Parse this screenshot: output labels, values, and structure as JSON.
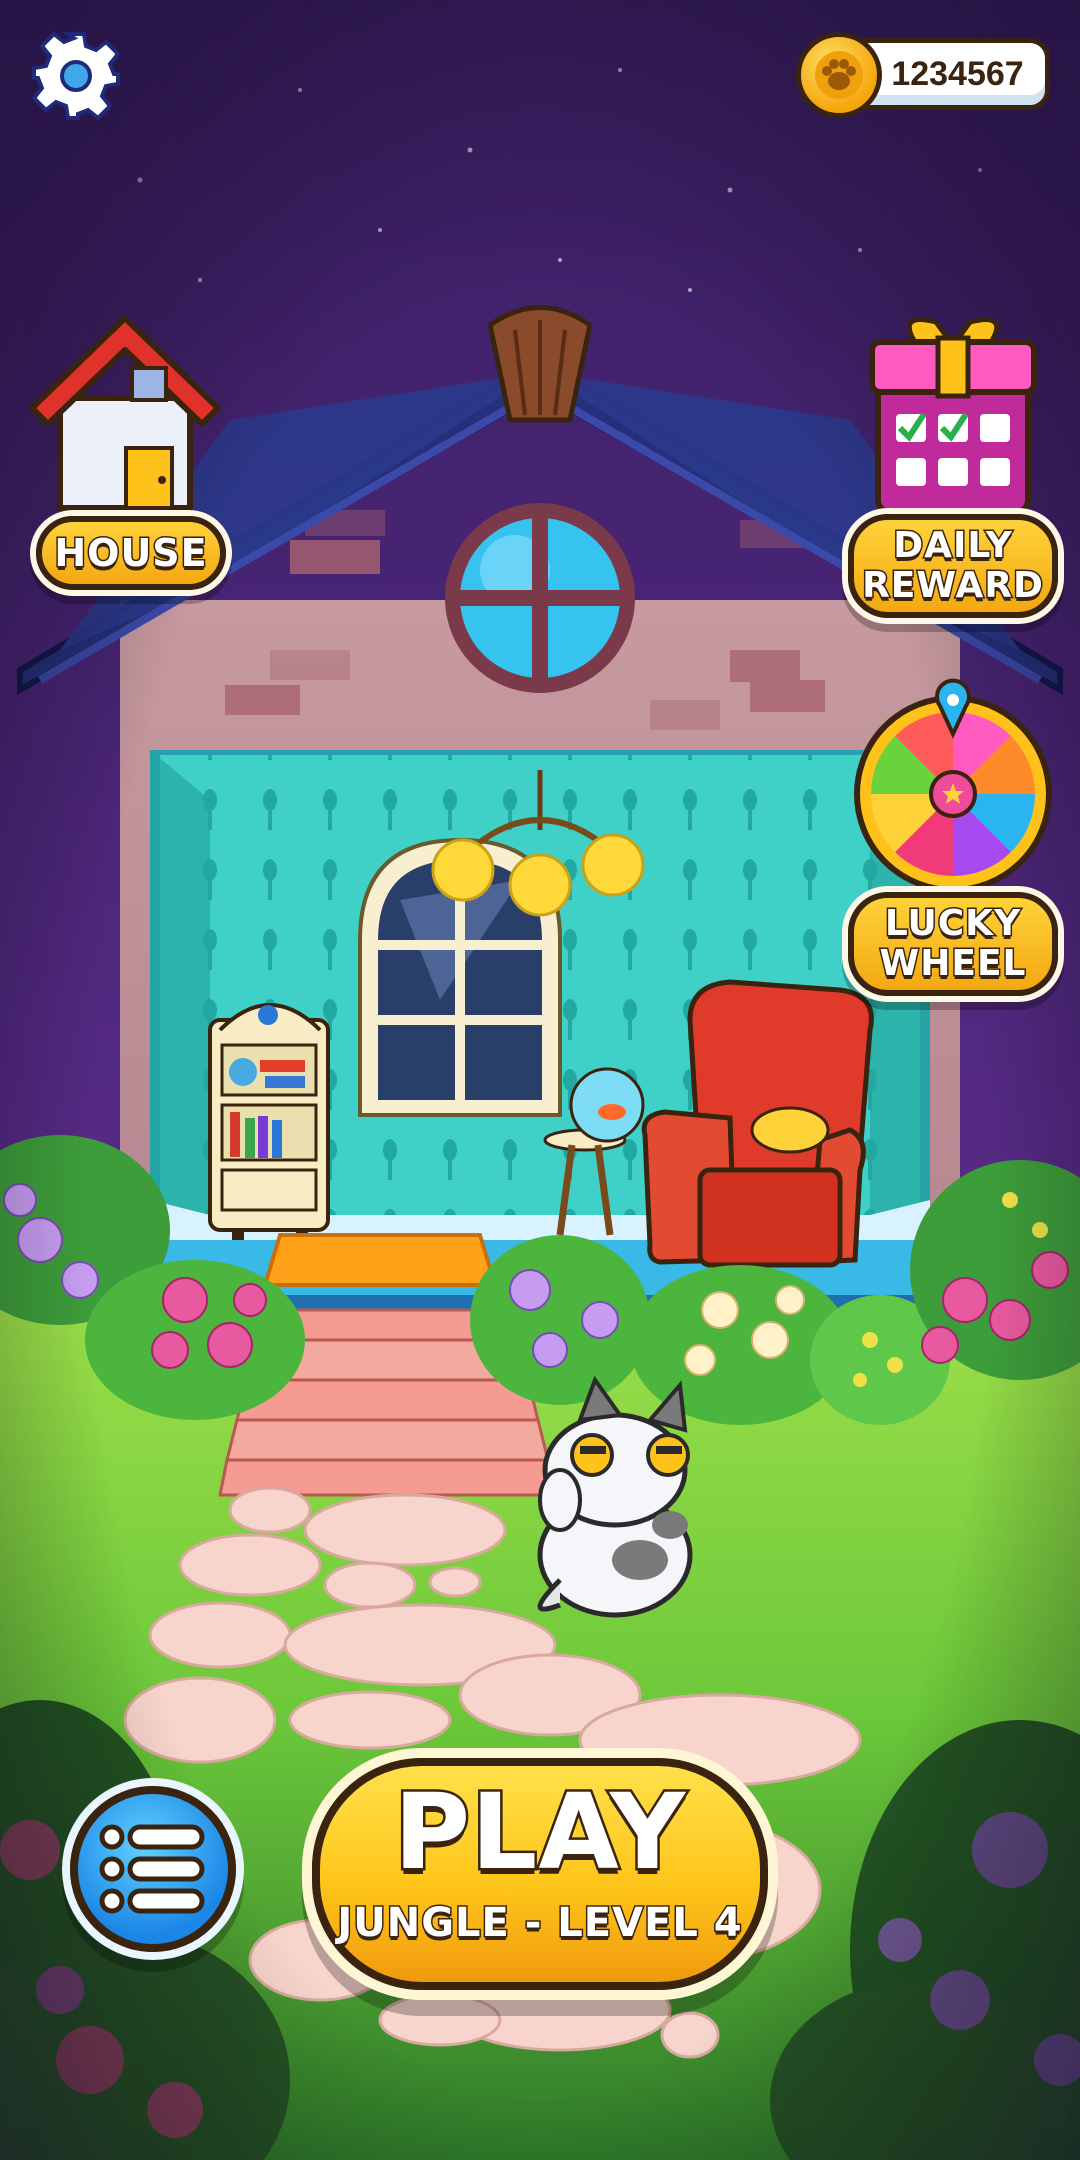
{
  "hud": {
    "settings_icon": "gear-icon",
    "coins": "1234567",
    "coin_icon": "paw-coin-icon"
  },
  "side_menu": {
    "house_label": "HOUSE",
    "daily_reward_line1": "DAILY",
    "daily_reward_line2": "REWARD",
    "lucky_wheel_line1": "LUCKY",
    "lucky_wheel_line2": "WHEEL"
  },
  "play": {
    "label": "PLAY",
    "subtitle": "JUNGLE - LEVEL 4"
  },
  "menu_icon": "list-menu-icon",
  "colors": {
    "night_sky": "#3b1f63",
    "accent_yellow": "#ffc61a",
    "outline_brown": "#3a2410",
    "menu_blue": "#1b86e6"
  }
}
